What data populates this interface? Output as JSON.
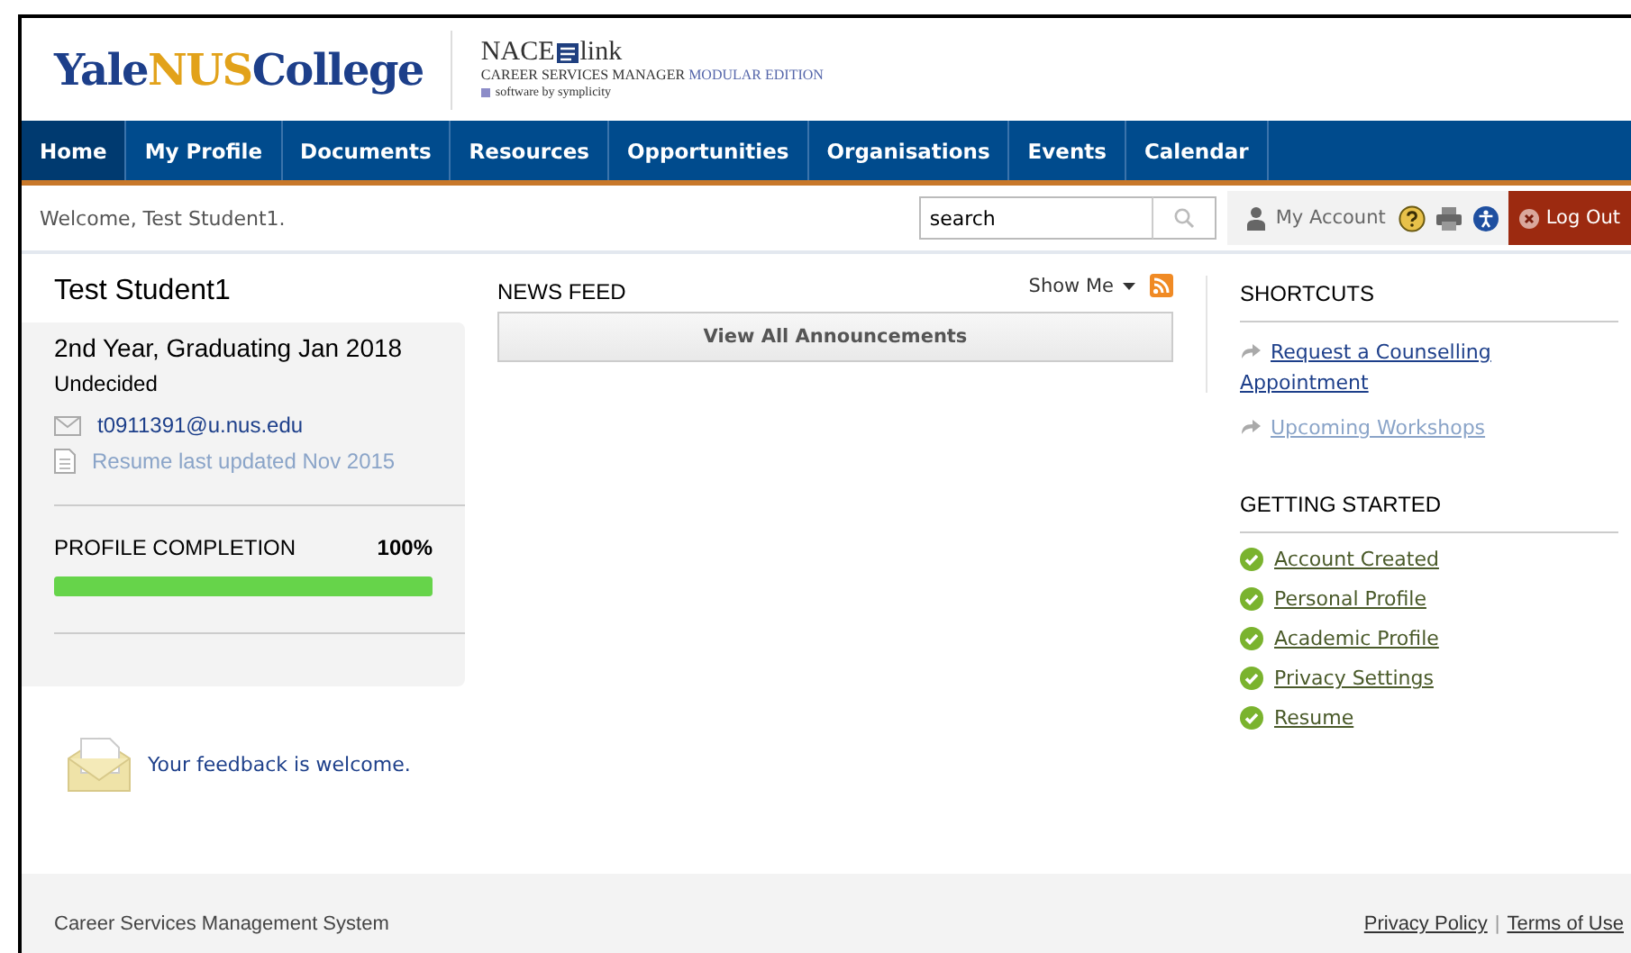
{
  "logo": {
    "parts": [
      "Yale",
      "NUS",
      "College"
    ]
  },
  "vendor": {
    "brand_left": "NACE",
    "brand_right": "link",
    "line": "CAREER SERVICES MANAGER",
    "edition": "MODULAR EDITION",
    "tagline": "software by symplicity"
  },
  "nav": [
    {
      "label": "Home",
      "selected": true
    },
    {
      "label": "My Profile",
      "selected": false
    },
    {
      "label": "Documents",
      "selected": false
    },
    {
      "label": "Resources",
      "selected": false
    },
    {
      "label": "Opportunities",
      "selected": false
    },
    {
      "label": "Organisations",
      "selected": false
    },
    {
      "label": "Events",
      "selected": false
    },
    {
      "label": "Calendar",
      "selected": false
    }
  ],
  "welcome": "Welcome, Test Student1.",
  "search": {
    "value": "search"
  },
  "account": "My Account",
  "logout": "Log Out",
  "profile": {
    "name": "Test Student1",
    "year": "2nd Year, Graduating Jan 2018",
    "major": "Undecided",
    "email": "t0911391@u.nus.edu",
    "resume": "Resume last updated Nov 2015",
    "completion_label": "PROFILE COMPLETION",
    "completion_value": "100%",
    "level": 1
  },
  "feedback": "Your feedback is welcome.",
  "news": {
    "title": "NEWS FEED",
    "show_me": "Show Me",
    "button": "View All Announcements"
  },
  "shortcuts": {
    "title": "SHORTCUTS",
    "items": [
      {
        "label": "Request a Counselling Appointment",
        "disabled": false
      },
      {
        "label": "Upcoming Workshops",
        "disabled": true
      }
    ]
  },
  "getting_started": {
    "title": "GETTING STARTED",
    "items": [
      {
        "label": "Account Created",
        "checked": true
      },
      {
        "label": "Personal Profile",
        "checked": true
      },
      {
        "label": "Academic Profile",
        "checked": true
      },
      {
        "label": "Privacy Settings",
        "checked": true
      },
      {
        "label": "Resume",
        "checked": true
      }
    ]
  },
  "footer": {
    "text": "Career Services Management System",
    "links": [
      "Privacy Policy",
      "Terms of Use"
    ],
    "separator": "|"
  }
}
